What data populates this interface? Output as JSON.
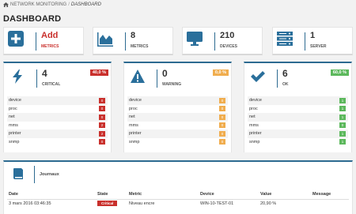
{
  "breadcrumb": {
    "root": "NETWORK MONITORING",
    "separator": "/",
    "current": "DASHBOARD",
    "icon": "home-icon"
  },
  "page_title": "DASHBOARD",
  "stats": [
    {
      "icon": "plus-square-icon",
      "value": "Add",
      "label": "METRICS",
      "color": "#2a6f9b"
    },
    {
      "icon": "area-chart-icon",
      "value": "8",
      "label": "METRICS",
      "color": "#2a6f9b"
    },
    {
      "icon": "monitor-icon",
      "value": "210",
      "label": "DEVICES",
      "color": "#2a6f9b"
    },
    {
      "icon": "server-icon",
      "value": "1",
      "label": "SERVER",
      "color": "#2a6f9b"
    }
  ],
  "status_panels": [
    {
      "icon": "bolt-icon",
      "count": "4",
      "label": "CRITICAL",
      "percent": "40,0 %",
      "color": "#c9302c",
      "rows": [
        {
          "name": "device",
          "count": "0"
        },
        {
          "name": "proc",
          "count": "0"
        },
        {
          "name": "net",
          "count": "0"
        },
        {
          "name": "mms",
          "count": "2"
        },
        {
          "name": "printer",
          "count": "2"
        },
        {
          "name": "snmp",
          "count": "0"
        }
      ]
    },
    {
      "icon": "warning-icon",
      "count": "0",
      "label": "WARNING",
      "percent": "0,0 %",
      "color": "#f0ad4e",
      "rows": [
        {
          "name": "device",
          "count": "0"
        },
        {
          "name": "proc",
          "count": "0"
        },
        {
          "name": "net",
          "count": "0"
        },
        {
          "name": "mms",
          "count": "0"
        },
        {
          "name": "printer",
          "count": "0"
        },
        {
          "name": "snmp",
          "count": "0"
        }
      ]
    },
    {
      "icon": "check-icon",
      "count": "6",
      "label": "OK",
      "percent": "60,0 %",
      "color": "#5cb85c",
      "rows": [
        {
          "name": "device",
          "count": "1"
        },
        {
          "name": "proc",
          "count": "1"
        },
        {
          "name": "net",
          "count": "1"
        },
        {
          "name": "mms",
          "count": "0"
        },
        {
          "name": "printer",
          "count": "1"
        },
        {
          "name": "snmp",
          "count": "1"
        }
      ]
    }
  ],
  "journal": {
    "icon": "book-icon",
    "title": "Journaux",
    "columns": [
      "Date",
      "State",
      "Metric",
      "Device",
      "Value",
      "Message"
    ],
    "rows": [
      {
        "date": "3 mars 2016 03:46:35",
        "state": "Critical",
        "metric": "Niveau encre",
        "device": "WIN-10-TEST-01",
        "value": "20,90 %",
        "message": ""
      }
    ]
  },
  "colors": {
    "accent": "#2d6b91",
    "critical": "#c9302c",
    "warning": "#f0ad4e",
    "ok": "#5cb85c"
  }
}
